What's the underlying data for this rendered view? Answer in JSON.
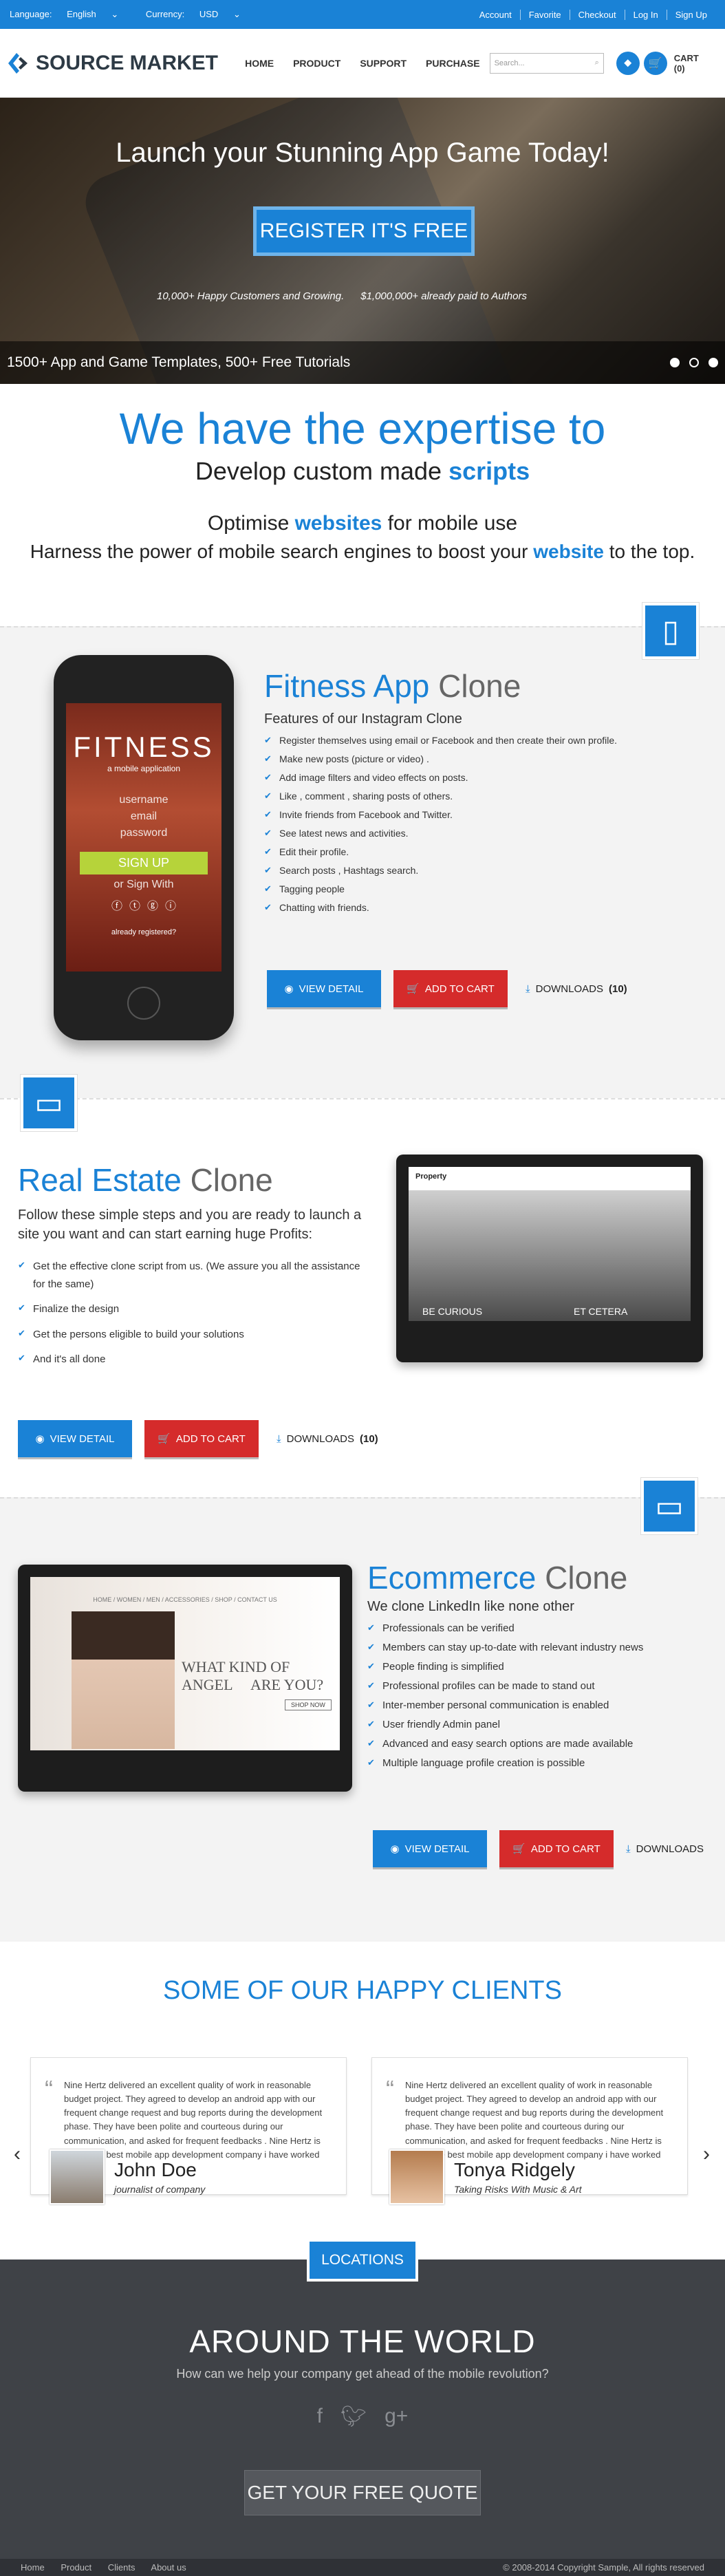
{
  "topbar": {
    "language_label": "Language:",
    "language_value": "English",
    "currency_label": "Currency:",
    "currency_value": "USD",
    "links": [
      "Account",
      "Favorite",
      "Checkout",
      "Log In",
      "Sign Up"
    ]
  },
  "header": {
    "logo_text": "SOURCE MARKET",
    "nav": [
      "HOME",
      "PRODUCT",
      "SUPPORT",
      "PURCHASE"
    ],
    "search_placeholder": "Search...",
    "cart_label": "CART",
    "cart_count": "(0)"
  },
  "hero": {
    "title": "Launch your Stunning App Game Today!",
    "cta": "REGISTER IT'S FREE",
    "stat1": "10,000+ Happy Customers and Growing.",
    "stat2": "$1,000,000+ already paid to Authors",
    "banner_text": "1500+ App and Game Templates, 500+ Free Tutorials"
  },
  "expertise": {
    "heading": "We have the expertise to",
    "line2_pre": "Develop custom made",
    "line2_hl": "scripts",
    "line3_pre": "Optimise",
    "line3_hl": "websites",
    "line3_post": "for mobile use",
    "line4_pre": "Harness the power of mobile search engines to boost your",
    "line4_hl": "website",
    "line4_post": "to the top."
  },
  "fitness": {
    "title_hl": "Fitness App",
    "title_rest": "Clone",
    "subtitle": "Features of our Instagram Clone",
    "features": [
      "Register themselves using email or Facebook and then create their own profile.",
      "Make new posts (picture or video) .",
      "Add image filters and video effects on posts.",
      "Like , comment , sharing posts of others.",
      "Invite friends from Facebook and Twitter.",
      "See latest news and activities.",
      "Edit their profile.",
      "Search posts , Hashtags search.",
      "Tagging people",
      "Chatting with friends."
    ],
    "screen": {
      "brand": "FITNESS",
      "tagline": "a mobile application",
      "f1": "username",
      "f2": "email",
      "f3": "password",
      "signup": "SIGN UP",
      "or": "or Sign With",
      "footer": "already registered?"
    },
    "view": "VIEW DETAIL",
    "cart": "ADD TO CART",
    "downloads": "DOWNLOADS",
    "downloads_count": "(10)"
  },
  "realestate": {
    "title_hl": "Real Estate",
    "title_rest": "Clone",
    "intro": "Follow these simple steps and you are ready to launch a site you want and can start earning huge Profits:",
    "features": [
      "Get the effective clone script from us. (We assure you all the assistance for the same)",
      "Finalize the design",
      "Get the persons eligible to build your solutions",
      "And it's all done"
    ],
    "screen": {
      "brand": "Property",
      "caption1": "BE CURIOUS",
      "caption2": "ET CETERA"
    },
    "view": "VIEW DETAIL",
    "cart": "ADD TO CART",
    "downloads": "DOWNLOADS",
    "downloads_count": "(10)"
  },
  "ecommerce": {
    "title_hl": "Ecommerce",
    "title_rest": "Clone",
    "subtitle": "We clone LinkedIn like none other",
    "features": [
      "Professionals can be verified",
      "Members can stay up-to-date with relevant industry news",
      "People finding is simplified",
      "Professional profiles can be made to stand out",
      "Inter-member personal communication is enabled",
      "User friendly Admin panel",
      "Advanced and easy search options are made available",
      "Multiple language profile creation is possible"
    ],
    "screen": {
      "nav": "HOME  /  WOMEN  /  MEN  /  ACCESSORIES  /  SHOP  /  CONTACT US",
      "headline1": "WHAT KIND OF ANGEL",
      "headline2": "ARE YOU?",
      "shop": "SHOP NOW"
    },
    "view": "VIEW DETAIL",
    "cart": "ADD TO CART",
    "downloads": "DOWNLOADS"
  },
  "clients": {
    "heading": "SOME OF OUR HAPPY CLIENTS",
    "testimonials": [
      {
        "text": "Nine Hertz delivered an excellent quality of work in reasonable budget project. They agreed to develop an android app with our frequent change request and bug reports during the development phase. They have been polite and courteous during our communication, and asked for frequent feedbacks . Nine Hertz is one of the best mobile app development company i have worked with.",
        "name": "John Doe",
        "role": "journalist of company"
      },
      {
        "text": "Nine Hertz delivered an excellent quality of work in reasonable budget project. They agreed to develop an android app with our frequent change request and bug reports during the development phase. They have been polite and courteous during our communication, and asked for frequent feedbacks . Nine Hertz is one of the best mobile app development company i have worked with.",
        "name": "Tonya Ridgely",
        "role": "Taking Risks With Music & Art"
      }
    ]
  },
  "world": {
    "locations": "LOCATIONS",
    "heading": "AROUND THE WORLD",
    "sub": "How can we help your company get ahead of the mobile revolution?",
    "quote_btn": "GET YOUR FREE QUOTE"
  },
  "footer": {
    "links": [
      "Home",
      "Product",
      "Clients",
      "About us"
    ],
    "copyright": "© 2008-2014 Copyright Sample, All rights reserved"
  },
  "colors": {
    "accent": "#1a82d6",
    "cart_red": "#d52b2b",
    "footer_dark": "#3f4247"
  }
}
